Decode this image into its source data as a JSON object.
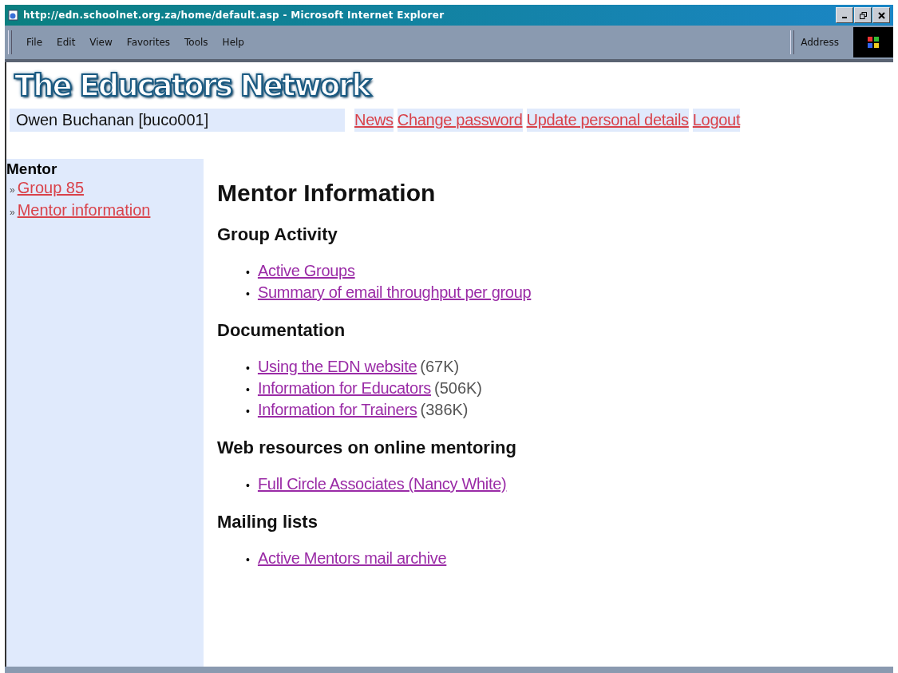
{
  "window": {
    "title": "http://edn.schoolnet.org.za/home/default.asp - Microsoft Internet Explorer"
  },
  "menu": [
    "File",
    "Edit",
    "View",
    "Favorites",
    "Tools",
    "Help"
  ],
  "address_label": "Address",
  "logo": "The Educators Network",
  "user": "Owen Buchanan [buco001]",
  "top_links": [
    "News",
    "Change password",
    "Update personal details",
    "Logout"
  ],
  "sidebar": {
    "title": "Mentor",
    "bullet": "»",
    "items": [
      "Group 85",
      "Mentor information"
    ]
  },
  "main": {
    "title": "Mentor Information",
    "bullet": "•",
    "sections": [
      {
        "heading": "Group Activity",
        "items": [
          {
            "link": "Active Groups"
          },
          {
            "link": "Summary of email throughput per group"
          }
        ]
      },
      {
        "heading": "Documentation",
        "items": [
          {
            "link": "Using the EDN website",
            "size": "(67K)"
          },
          {
            "link": "Information for Educators",
            "size": "(506K)"
          },
          {
            "link": "Information for Trainers",
            "size": "(386K)"
          }
        ]
      },
      {
        "heading": "Web resources on online mentoring",
        "items": [
          {
            "link": "Full Circle Associates (Nancy White)"
          }
        ]
      },
      {
        "heading": "Mailing lists",
        "items": [
          {
            "link": "Active Mentors mail archive"
          }
        ]
      }
    ]
  }
}
